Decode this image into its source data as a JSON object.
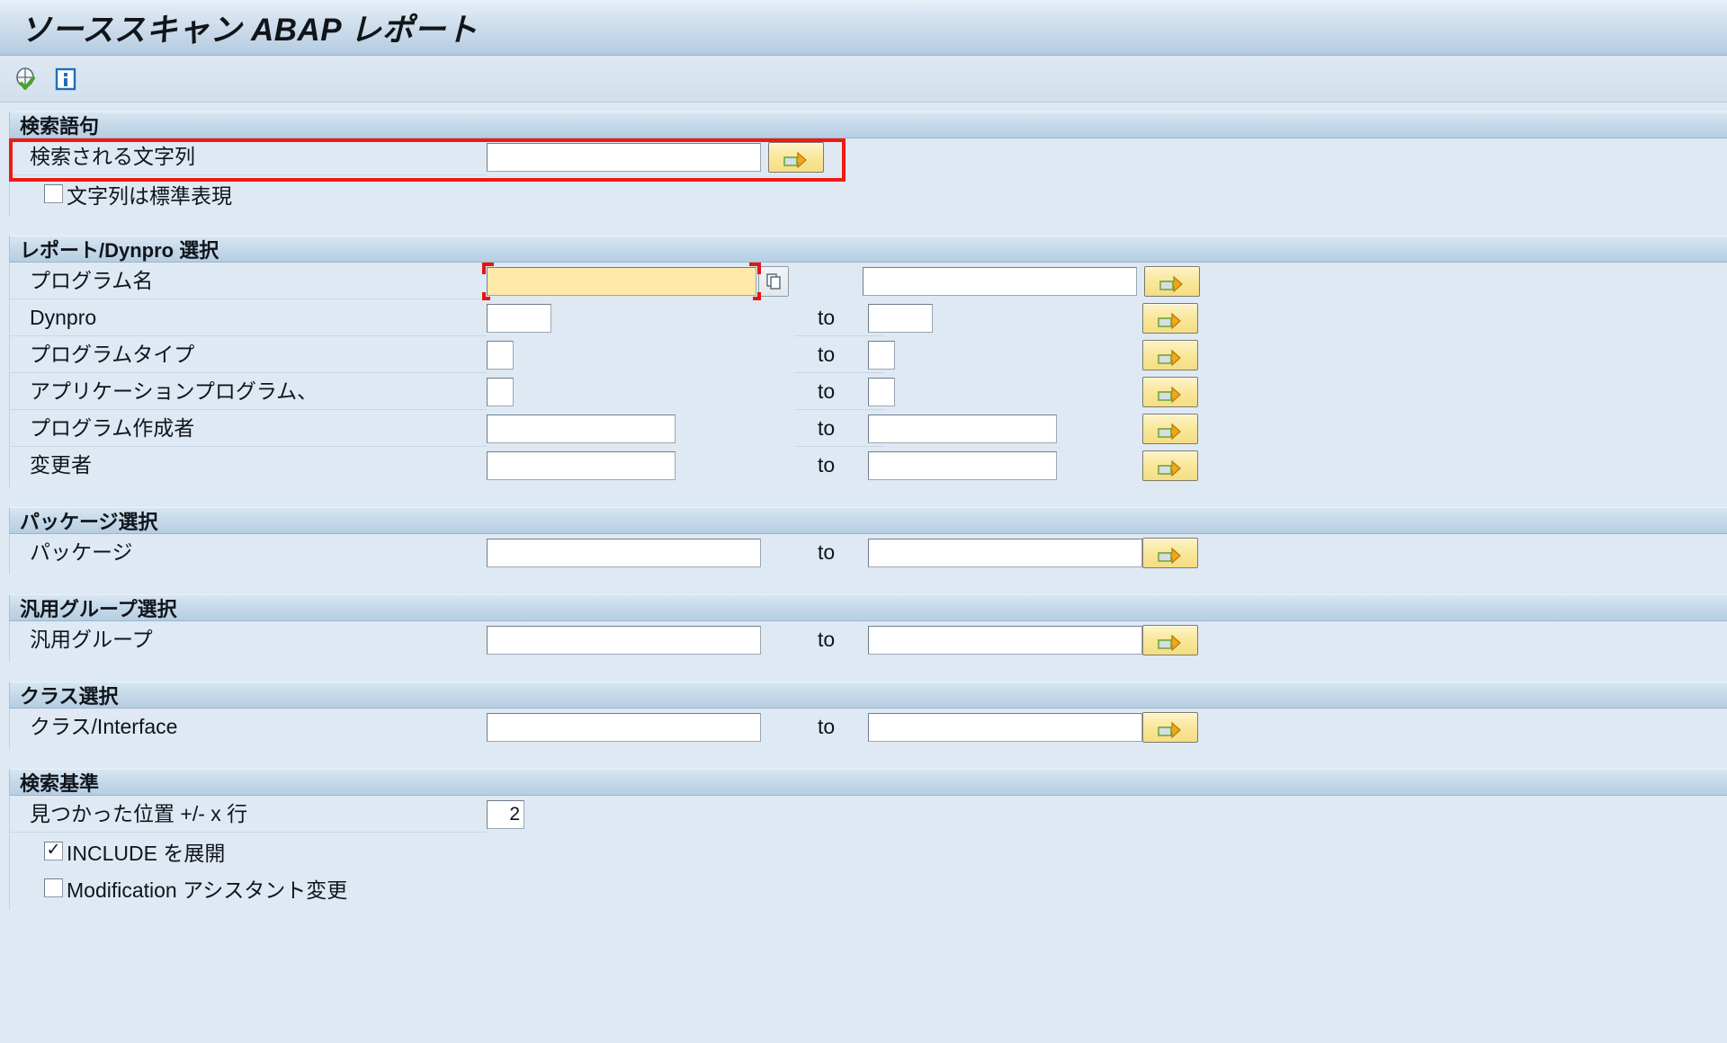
{
  "window": {
    "title": "ソーススキャン ABAP レポート"
  },
  "toolbar": {
    "items": [
      {
        "name": "execute-icon",
        "tooltip": "実行"
      },
      {
        "name": "info-icon",
        "tooltip": "情報"
      }
    ]
  },
  "sections": {
    "search_terms": {
      "header": "検索語句",
      "search_string_label": "検索される文字列",
      "search_string_value": "",
      "multi_select_label": "",
      "regex_checkbox_label": "文字列は標準表現",
      "regex_checked": false
    },
    "report_dynpro": {
      "header": "レポート/Dynpro 選択",
      "to_label": "to",
      "rows": [
        {
          "label": "プログラム名",
          "from": "",
          "to": "",
          "focused": true
        },
        {
          "label": "Dynpro",
          "from": "",
          "to": "",
          "focused": false
        },
        {
          "label": "プログラムタイプ",
          "from": "",
          "to": "",
          "focused": false
        },
        {
          "label": "アプリケーションプログラム、",
          "from": "",
          "to": "",
          "focused": false
        },
        {
          "label": "プログラム作成者",
          "from": "",
          "to": "",
          "focused": false
        },
        {
          "label": "変更者",
          "from": "",
          "to": "",
          "focused": false
        }
      ]
    },
    "package": {
      "header": "パッケージ選択",
      "to_label": "to",
      "row_label": "パッケージ",
      "from": "",
      "to": ""
    },
    "function_group": {
      "header": "汎用グループ選択",
      "to_label": "to",
      "row_label": "汎用グループ",
      "from": "",
      "to": ""
    },
    "class": {
      "header": "クラス選択",
      "to_label": "to",
      "row_label": "クラス/Interface",
      "from": "",
      "to": ""
    },
    "search_criteria": {
      "header": "検索基準",
      "context_lines_label": "見つかった位置 +/- x 行",
      "context_lines_value": "2",
      "expand_include_label": "INCLUDE を展開",
      "expand_include_checked": true,
      "modification_label": "Modification アシスタント変更",
      "modification_checked": false
    }
  },
  "colors": {
    "accent_blue": "#b6cee2",
    "page_bg": "#dfe9f4",
    "focus_field": "#ffe9a8",
    "annotation_red": "#ee1b12",
    "button_yellow": "#f9e79a"
  }
}
